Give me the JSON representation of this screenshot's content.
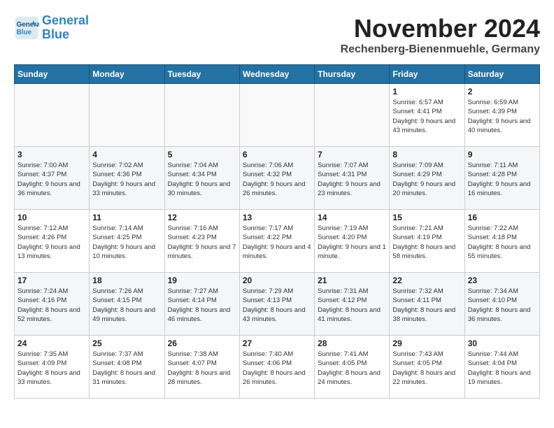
{
  "header": {
    "logo_line1": "General",
    "logo_line2": "Blue",
    "month": "November 2024",
    "location": "Rechenberg-Bienenmuehle, Germany"
  },
  "weekdays": [
    "Sunday",
    "Monday",
    "Tuesday",
    "Wednesday",
    "Thursday",
    "Friday",
    "Saturday"
  ],
  "weeks": [
    [
      {
        "day": "",
        "info": ""
      },
      {
        "day": "",
        "info": ""
      },
      {
        "day": "",
        "info": ""
      },
      {
        "day": "",
        "info": ""
      },
      {
        "day": "",
        "info": ""
      },
      {
        "day": "1",
        "info": "Sunrise: 6:57 AM\nSunset: 4:41 PM\nDaylight: 9 hours\nand 43 minutes."
      },
      {
        "day": "2",
        "info": "Sunrise: 6:59 AM\nSunset: 4:39 PM\nDaylight: 9 hours\nand 40 minutes."
      }
    ],
    [
      {
        "day": "3",
        "info": "Sunrise: 7:00 AM\nSunset: 4:37 PM\nDaylight: 9 hours\nand 36 minutes."
      },
      {
        "day": "4",
        "info": "Sunrise: 7:02 AM\nSunset: 4:36 PM\nDaylight: 9 hours\nand 33 minutes."
      },
      {
        "day": "5",
        "info": "Sunrise: 7:04 AM\nSunset: 4:34 PM\nDaylight: 9 hours\nand 30 minutes."
      },
      {
        "day": "6",
        "info": "Sunrise: 7:06 AM\nSunset: 4:32 PM\nDaylight: 9 hours\nand 26 minutes."
      },
      {
        "day": "7",
        "info": "Sunrise: 7:07 AM\nSunset: 4:31 PM\nDaylight: 9 hours\nand 23 minutes."
      },
      {
        "day": "8",
        "info": "Sunrise: 7:09 AM\nSunset: 4:29 PM\nDaylight: 9 hours\nand 20 minutes."
      },
      {
        "day": "9",
        "info": "Sunrise: 7:11 AM\nSunset: 4:28 PM\nDaylight: 9 hours\nand 16 minutes."
      }
    ],
    [
      {
        "day": "10",
        "info": "Sunrise: 7:12 AM\nSunset: 4:26 PM\nDaylight: 9 hours\nand 13 minutes."
      },
      {
        "day": "11",
        "info": "Sunrise: 7:14 AM\nSunset: 4:25 PM\nDaylight: 9 hours\nand 10 minutes."
      },
      {
        "day": "12",
        "info": "Sunrise: 7:16 AM\nSunset: 4:23 PM\nDaylight: 9 hours\nand 7 minutes."
      },
      {
        "day": "13",
        "info": "Sunrise: 7:17 AM\nSunset: 4:22 PM\nDaylight: 9 hours\nand 4 minutes."
      },
      {
        "day": "14",
        "info": "Sunrise: 7:19 AM\nSunset: 4:20 PM\nDaylight: 9 hours\nand 1 minute."
      },
      {
        "day": "15",
        "info": "Sunrise: 7:21 AM\nSunset: 4:19 PM\nDaylight: 8 hours\nand 58 minutes."
      },
      {
        "day": "16",
        "info": "Sunrise: 7:22 AM\nSunset: 4:18 PM\nDaylight: 8 hours\nand 55 minutes."
      }
    ],
    [
      {
        "day": "17",
        "info": "Sunrise: 7:24 AM\nSunset: 4:16 PM\nDaylight: 8 hours\nand 52 minutes."
      },
      {
        "day": "18",
        "info": "Sunrise: 7:26 AM\nSunset: 4:15 PM\nDaylight: 8 hours\nand 49 minutes."
      },
      {
        "day": "19",
        "info": "Sunrise: 7:27 AM\nSunset: 4:14 PM\nDaylight: 8 hours\nand 46 minutes."
      },
      {
        "day": "20",
        "info": "Sunrise: 7:29 AM\nSunset: 4:13 PM\nDaylight: 8 hours\nand 43 minutes."
      },
      {
        "day": "21",
        "info": "Sunrise: 7:31 AM\nSunset: 4:12 PM\nDaylight: 8 hours\nand 41 minutes."
      },
      {
        "day": "22",
        "info": "Sunrise: 7:32 AM\nSunset: 4:11 PM\nDaylight: 8 hours\nand 38 minutes."
      },
      {
        "day": "23",
        "info": "Sunrise: 7:34 AM\nSunset: 4:10 PM\nDaylight: 8 hours\nand 36 minutes."
      }
    ],
    [
      {
        "day": "24",
        "info": "Sunrise: 7:35 AM\nSunset: 4:09 PM\nDaylight: 8 hours\nand 33 minutes."
      },
      {
        "day": "25",
        "info": "Sunrise: 7:37 AM\nSunset: 4:08 PM\nDaylight: 8 hours\nand 31 minutes."
      },
      {
        "day": "26",
        "info": "Sunrise: 7:38 AM\nSunset: 4:07 PM\nDaylight: 8 hours\nand 28 minutes."
      },
      {
        "day": "27",
        "info": "Sunrise: 7:40 AM\nSunset: 4:06 PM\nDaylight: 8 hours\nand 26 minutes."
      },
      {
        "day": "28",
        "info": "Sunrise: 7:41 AM\nSunset: 4:05 PM\nDaylight: 8 hours\nand 24 minutes."
      },
      {
        "day": "29",
        "info": "Sunrise: 7:43 AM\nSunset: 4:05 PM\nDaylight: 8 hours\nand 22 minutes."
      },
      {
        "day": "30",
        "info": "Sunrise: 7:44 AM\nSunset: 4:04 PM\nDaylight: 8 hours\nand 19 minutes."
      }
    ]
  ]
}
